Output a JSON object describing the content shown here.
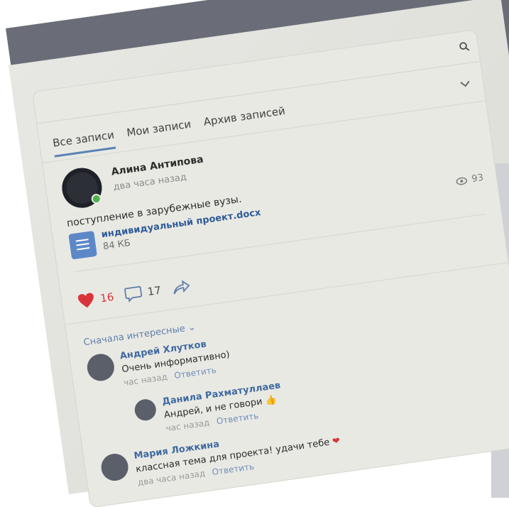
{
  "tabs": [
    "Все записи",
    "Мои записи",
    "Архив записей"
  ],
  "post": {
    "author": "Алина Антипова",
    "time": "два часа назад",
    "text": "поступление в зарубежные вузы.",
    "attachment": {
      "name": "индивидуальный проект.docx",
      "size": "84 КБ"
    },
    "views": "93",
    "likes": "16",
    "comments_count": "17"
  },
  "comments_sort": "Сначала интересные",
  "comments": [
    {
      "author": "Андрей Хлутков",
      "text": "Очень информативно)",
      "time": "час назад",
      "reply": "Ответить"
    },
    {
      "author": "Данила Рахматуллаев",
      "text": "Андрей, и не говори",
      "time": "час назад",
      "reply": "Ответить"
    },
    {
      "author": "Мария Ложкина",
      "text": "классная тема для проекта! удачи тебе",
      "time": "два часа назад",
      "reply": "Ответить"
    }
  ],
  "colors": {
    "accent": "#5b82b5",
    "like": "#d9343a",
    "link": "#3f6aa0"
  }
}
